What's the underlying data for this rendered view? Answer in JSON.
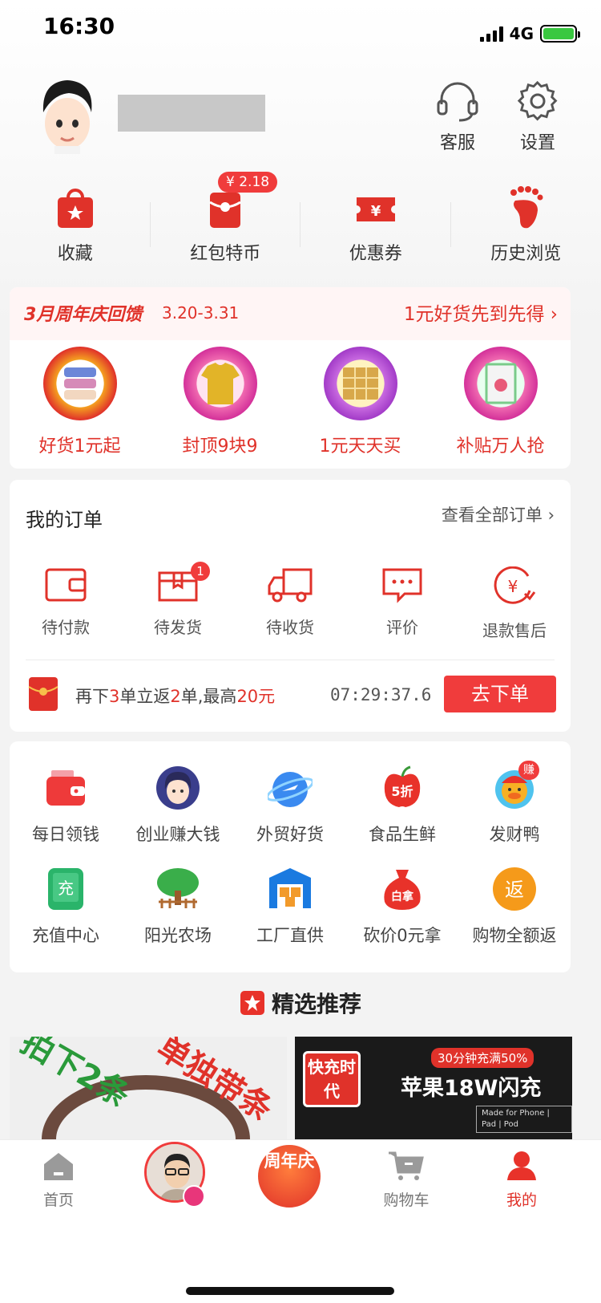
{
  "status_bar": {
    "time": "16:30",
    "network": "4G"
  },
  "header": {
    "service_label": "客服",
    "settings_label": "设置"
  },
  "quick_actions": [
    {
      "label": "收藏",
      "icon": "bag-star-icon"
    },
    {
      "label": "红包特币",
      "icon": "red-packet-icon",
      "badge": "¥ 2.18"
    },
    {
      "label": "优惠券",
      "icon": "coupon-icon"
    },
    {
      "label": "历史浏览",
      "icon": "footprint-icon"
    }
  ],
  "promo": {
    "title": "3月周年庆回馈",
    "date": "3.20-3.31",
    "link": "1元好货先到先得",
    "items": [
      {
        "label": "好货1元起",
        "icon": "towel-icon"
      },
      {
        "label": "封顶9块9",
        "icon": "tshirt-icon"
      },
      {
        "label": "1元天天买",
        "icon": "tissue-box-icon"
      },
      {
        "label": "补贴万人抢",
        "icon": "book-icon"
      }
    ]
  },
  "orders": {
    "title": "我的订单",
    "view_all": "查看全部订单",
    "items": [
      {
        "label": "待付款",
        "icon": "wallet-icon"
      },
      {
        "label": "待发货",
        "icon": "box-icon",
        "badge": "1"
      },
      {
        "label": "待收货",
        "icon": "truck-icon"
      },
      {
        "label": "评价",
        "icon": "comment-icon"
      },
      {
        "label": "退款售后",
        "icon": "refund-icon"
      }
    ],
    "reward": {
      "text_a": "再下",
      "num_a": "3",
      "text_b": "单立返",
      "num_b": "2",
      "text_c": "单,最高",
      "num_c": "20元",
      "countdown": "07:29:37.6",
      "button": "去下单"
    }
  },
  "services": [
    {
      "label": "每日领钱",
      "icon": "red-wallet-icon"
    },
    {
      "label": "创业赚大钱",
      "icon": "avatar-girl-icon"
    },
    {
      "label": "外贸好货",
      "icon": "globe-plane-icon"
    },
    {
      "label": "食品生鲜",
      "icon": "apple-discount-icon",
      "sticker": "5折"
    },
    {
      "label": "发财鸭",
      "icon": "lucky-duck-icon",
      "badge": "赚"
    },
    {
      "label": "充值中心",
      "icon": "recharge-phone-icon",
      "sticker": "充"
    },
    {
      "label": "阳光农场",
      "icon": "tree-icon"
    },
    {
      "label": "工厂直供",
      "icon": "factory-icon"
    },
    {
      "label": "砍价0元拿",
      "icon": "money-bag-icon",
      "sticker": "白拿"
    },
    {
      "label": "购物全额返",
      "icon": "refund-coin-icon",
      "sticker": "返"
    }
  ],
  "recommend": {
    "title": "精选推荐",
    "left_product": {
      "text_a": "拍下2条",
      "text_b": "单独带条"
    },
    "right_product": {
      "fast": "快充时代",
      "tag": "30分钟充满50%",
      "title": "苹果18W闪充",
      "made_for": "Made for Phone | Pad | Pod"
    }
  },
  "tabbar": {
    "home": "首页",
    "anniversary": "周年庆",
    "cart": "购物车",
    "mine": "我的"
  },
  "colors": {
    "accent": "#e0322a",
    "badge": "#f03c3c"
  }
}
